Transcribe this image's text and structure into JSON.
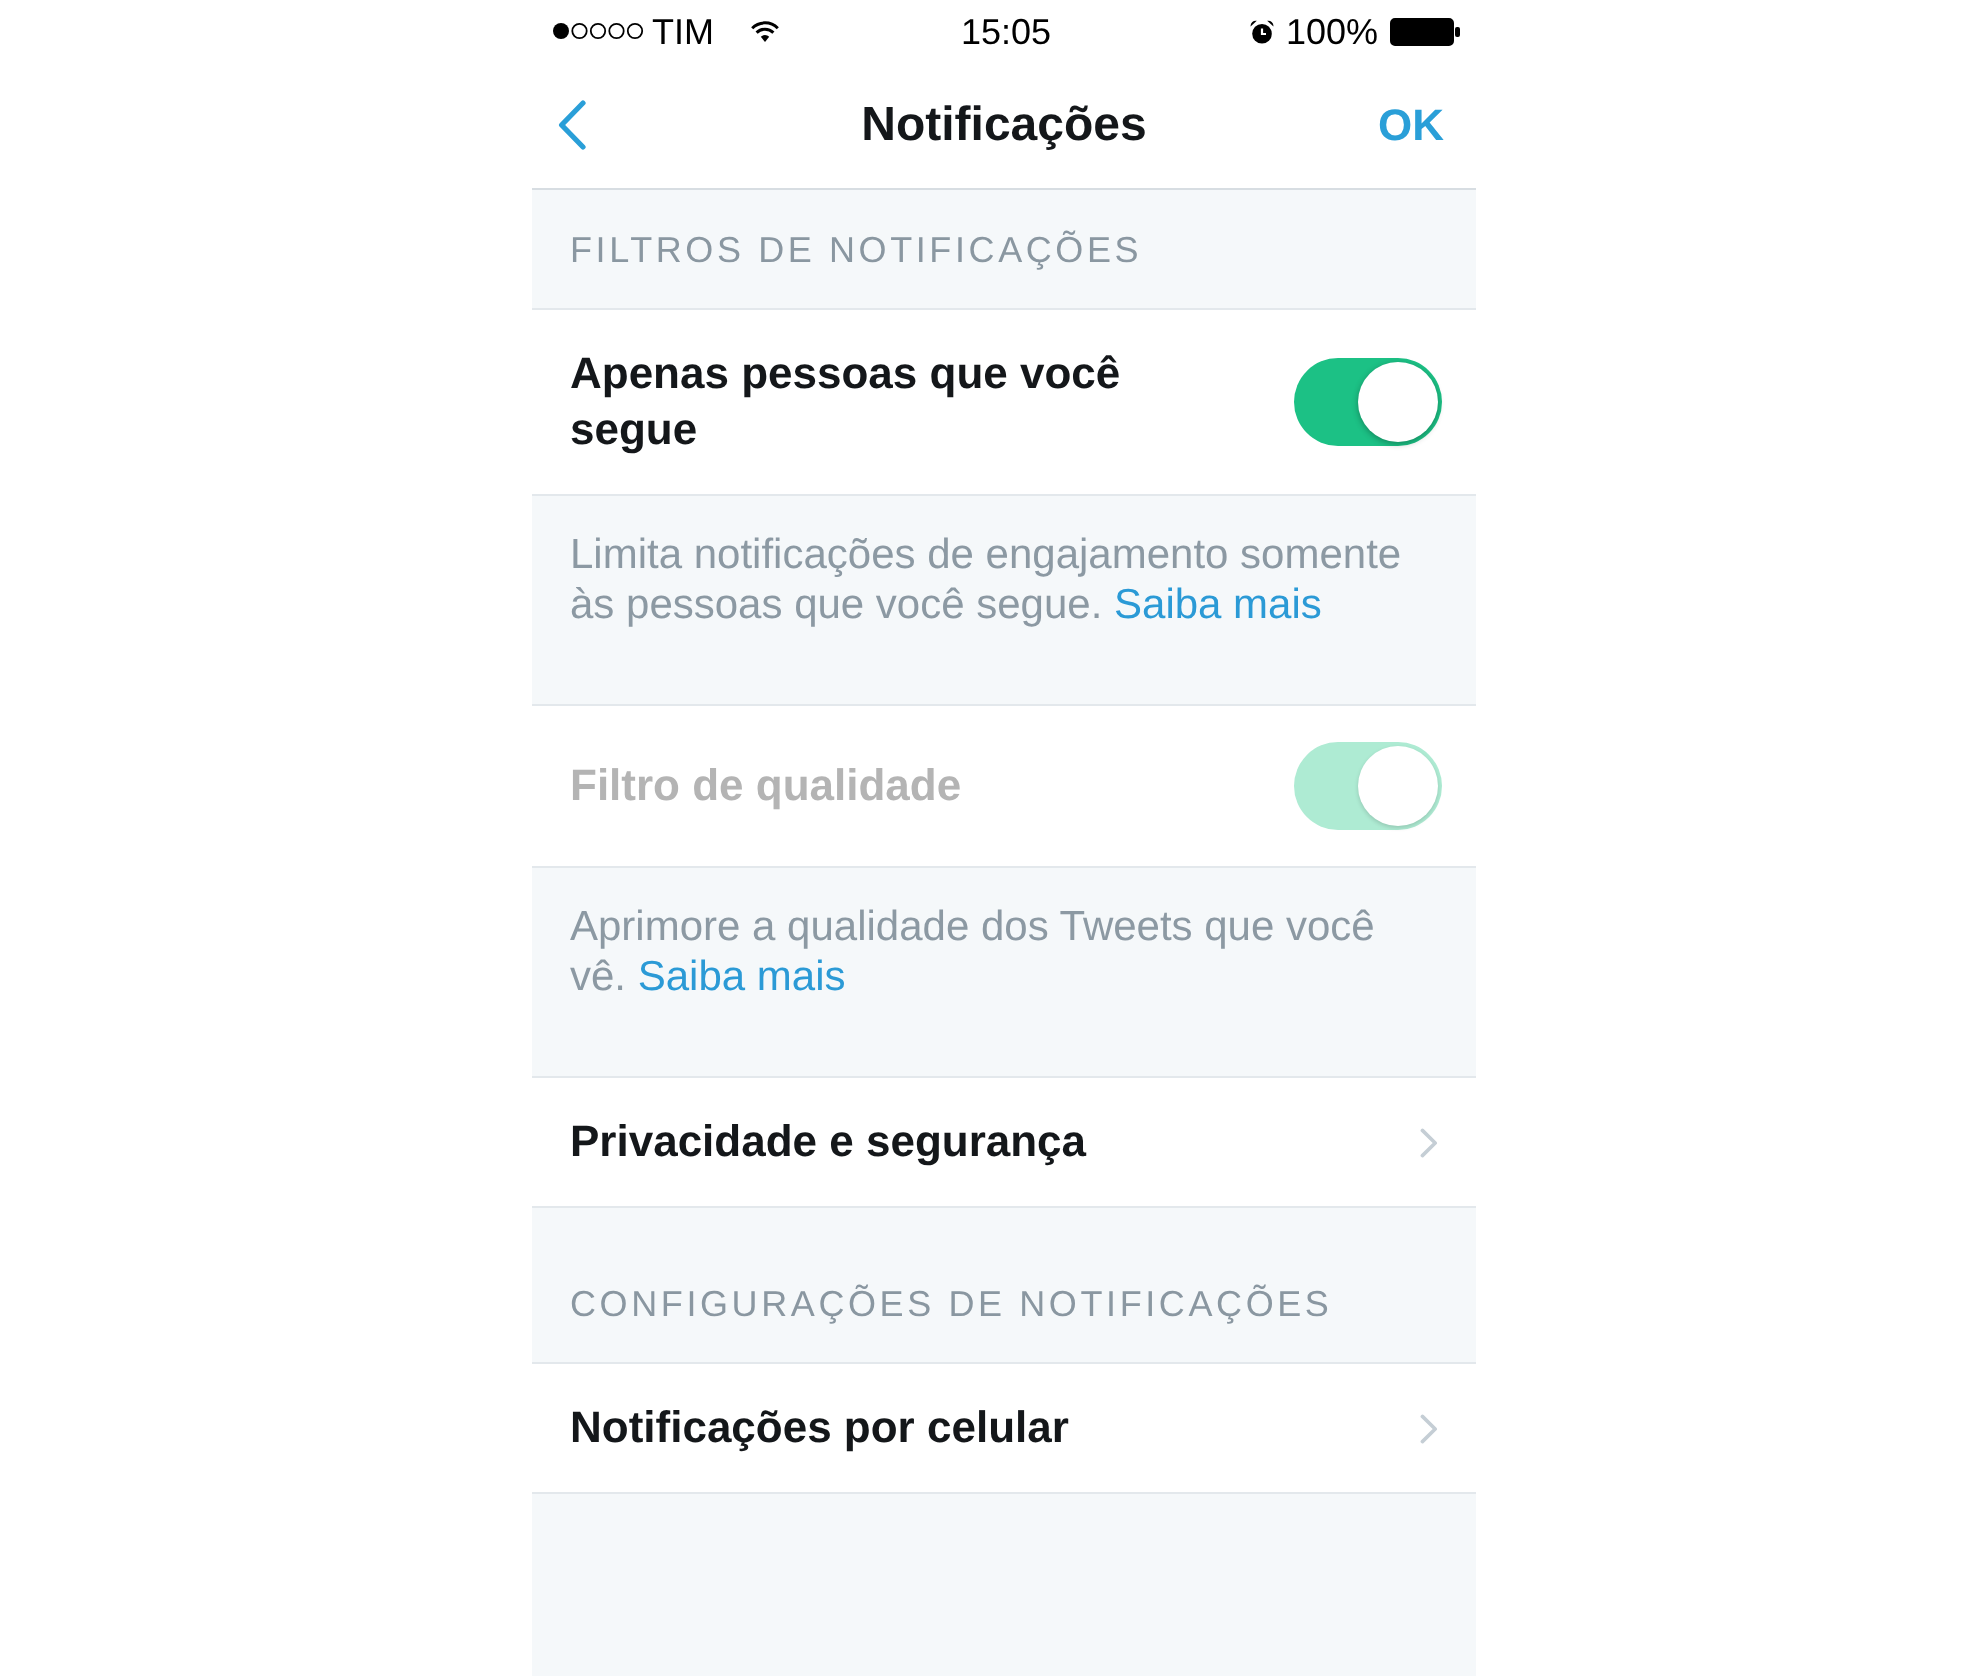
{
  "status_bar": {
    "carrier": "TIM",
    "time": "15:05",
    "battery": "100%"
  },
  "nav_bar": {
    "title": "Notificações",
    "action": "OK"
  },
  "sections": [
    {
      "header": "FILTROS DE NOTIFICAÇÕES",
      "items": [
        {
          "kind": "toggle",
          "label": "Apenas pessoas que você segue",
          "on": true,
          "disabled": false,
          "description": "Limita notificações de engajamento somente às pessoas que você segue.",
          "link": "Saiba mais"
        },
        {
          "kind": "toggle",
          "label": "Filtro de qualidade",
          "on": true,
          "disabled": true,
          "description": "Aprimore a qualidade dos Tweets que você vê.",
          "link": "Saiba mais"
        },
        {
          "kind": "link",
          "label": "Privacidade e segurança"
        }
      ]
    },
    {
      "header": "CONFIGURAÇÕES DE NOTIFICAÇÕES",
      "items": [
        {
          "kind": "link",
          "label": "Notificações por celular"
        }
      ]
    }
  ]
}
